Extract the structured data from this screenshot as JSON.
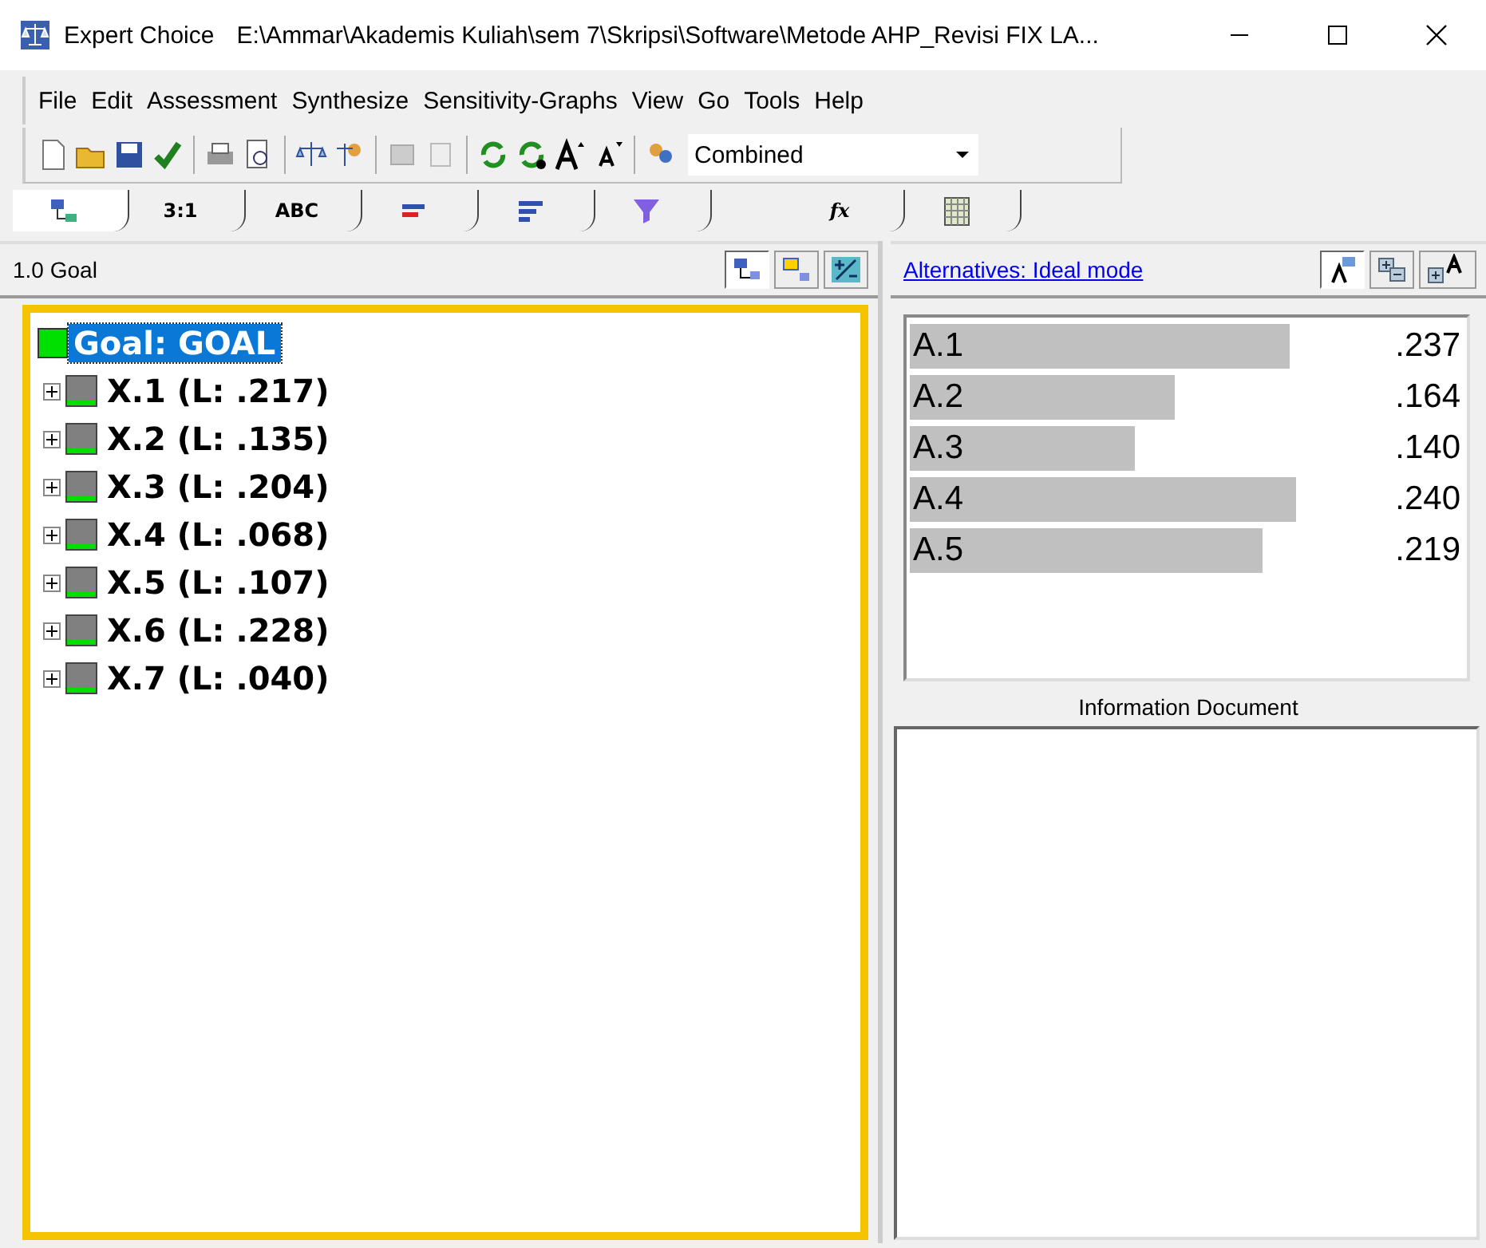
{
  "window": {
    "app_name": "Expert Choice",
    "path": "E:\\Ammar\\Akademis Kuliah\\sem 7\\Skripsi\\Software\\Metode AHP_Revisi FIX LA..."
  },
  "menu": [
    "File",
    "Edit",
    "Assessment",
    "Synthesize",
    "Sensitivity-Graphs",
    "View",
    "Go",
    "Tools",
    "Help"
  ],
  "toolbar": {
    "combo": "Combined"
  },
  "tabs": [
    {
      "kind": "icon",
      "selected": true
    },
    {
      "kind": "text",
      "label": "3:1",
      "selected": false
    },
    {
      "kind": "text",
      "label": "ABC",
      "selected": false
    },
    {
      "kind": "icon",
      "selected": false
    },
    {
      "kind": "icon",
      "selected": false
    },
    {
      "kind": "icon",
      "selected": false
    },
    {
      "kind": "text",
      "label": "fx",
      "selected": false
    },
    {
      "kind": "icon",
      "selected": false
    }
  ],
  "left_pane": {
    "header": "1.0 Goal",
    "tree": {
      "label": "Goal: GOAL",
      "selected": true,
      "children": [
        {
          "label": "X.1 (L: .217)",
          "expanded": false
        },
        {
          "label": "X.2 (L: .135)",
          "expanded": false
        },
        {
          "label": "X.3 (L: .204)",
          "expanded": false
        },
        {
          "label": "X.4 (L: .068)",
          "expanded": false
        },
        {
          "label": "X.5 (L: .107)",
          "expanded": false
        },
        {
          "label": "X.6 (L: .228)",
          "expanded": false
        },
        {
          "label": "X.7 (L: .040)",
          "expanded": false
        }
      ]
    }
  },
  "right_pane": {
    "link": "Alternatives: Ideal mode",
    "alternatives": [
      {
        "name": "A.1",
        "value": ".237",
        "level": 0.69
      },
      {
        "name": "A.2",
        "value": ".164",
        "level": 0.48
      },
      {
        "name": "A.3",
        "value": ".140",
        "level": 0.41
      },
      {
        "name": "A.4",
        "value": ".240",
        "level": 0.7
      },
      {
        "name": "A.5",
        "value": ".219",
        "level": 0.64
      }
    ],
    "info_label": "Information Document"
  }
}
